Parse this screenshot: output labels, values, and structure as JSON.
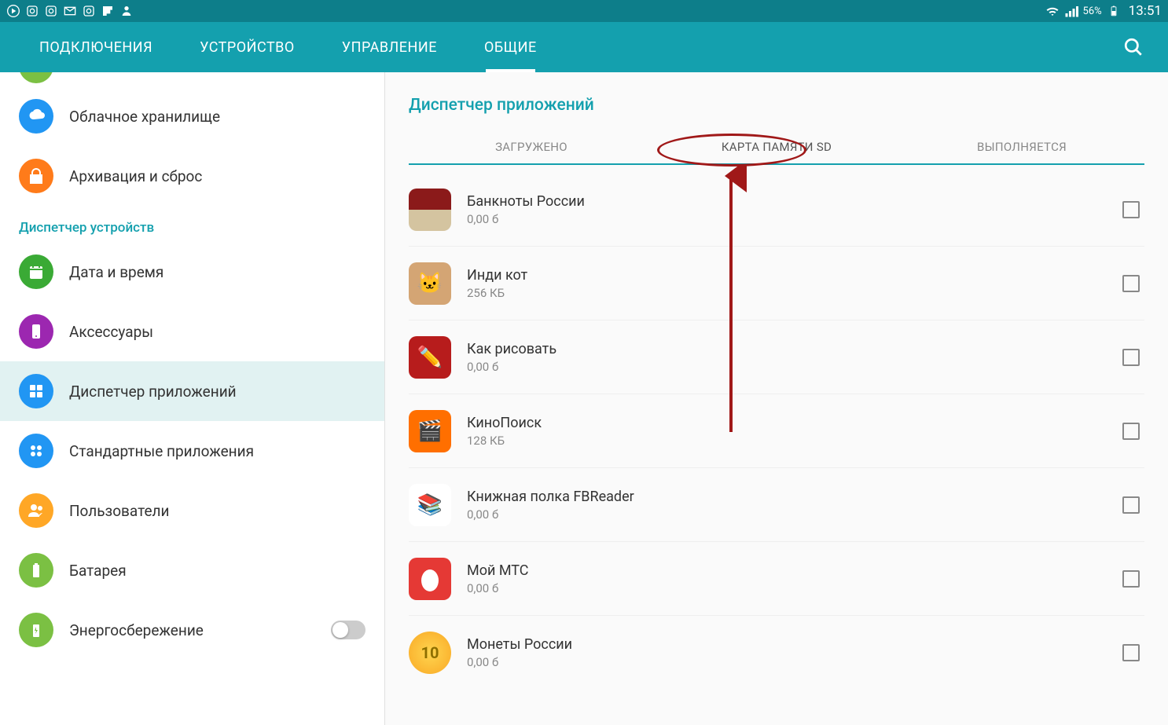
{
  "status_bar": {
    "battery_percent": "56%",
    "time": "13:51"
  },
  "tabs": {
    "items": [
      {
        "label": "ПОДКЛЮЧЕНИЯ"
      },
      {
        "label": "УСТРОЙСТВО"
      },
      {
        "label": "УПРАВЛЕНИЕ"
      },
      {
        "label": "ОБЩИЕ"
      }
    ],
    "active_index": 3
  },
  "sidebar": {
    "items": [
      {
        "label": "Облачное хранилище",
        "icon_color": "#2196f3"
      },
      {
        "label": "Архивация и сброс",
        "icon_color": "#ff7b1a"
      }
    ],
    "category": "Диспетчер устройств",
    "items2": [
      {
        "label": "Дата и время",
        "icon_color": "#3aaa35"
      },
      {
        "label": "Аксессуары",
        "icon_color": "#9c27b0"
      },
      {
        "label": "Диспетчер приложений",
        "icon_color": "#2196f3",
        "selected": true
      },
      {
        "label": "Стандартные приложения",
        "icon_color": "#2196f3"
      },
      {
        "label": "Пользователи",
        "icon_color": "#ffa726"
      },
      {
        "label": "Батарея",
        "icon_color": "#7bc043"
      },
      {
        "label": "Энергосбережение",
        "icon_color": "#7bc043",
        "has_toggle": true
      }
    ]
  },
  "main": {
    "title": "Диспетчер приложений",
    "subtabs": [
      {
        "label": "ЗАГРУЖЕНО"
      },
      {
        "label": "КАРТА ПАМЯТИ SD"
      },
      {
        "label": "ВЫПОЛНЯЕТСЯ"
      }
    ],
    "active_subtab": 1,
    "apps": [
      {
        "name": "Банкноты России",
        "size": "0,00 б",
        "icon_bg": "#8b1a1a",
        "emoji": "💴"
      },
      {
        "name": "Инди кот",
        "size": "256 КБ",
        "icon_bg": "#d4a574",
        "emoji": "🐱"
      },
      {
        "name": "Как рисовать",
        "size": "0,00 б",
        "icon_bg": "#b71c1c",
        "emoji": "✏️"
      },
      {
        "name": "КиноПоиск",
        "size": "128 КБ",
        "icon_bg": "#ff6f00",
        "emoji": "🎬"
      },
      {
        "name": "Книжная полка FBReader",
        "size": "0,00 б",
        "icon_bg": "#d32f2f",
        "emoji": "📚"
      },
      {
        "name": "Мой МТС",
        "size": "0,00 б",
        "icon_bg": "#e53935",
        "emoji": "🥚"
      },
      {
        "name": "Монеты России",
        "size": "0,00 б",
        "icon_bg": "#fdd835",
        "emoji": "🪙"
      }
    ]
  },
  "annotation": {
    "highlighted_subtab": 1
  }
}
